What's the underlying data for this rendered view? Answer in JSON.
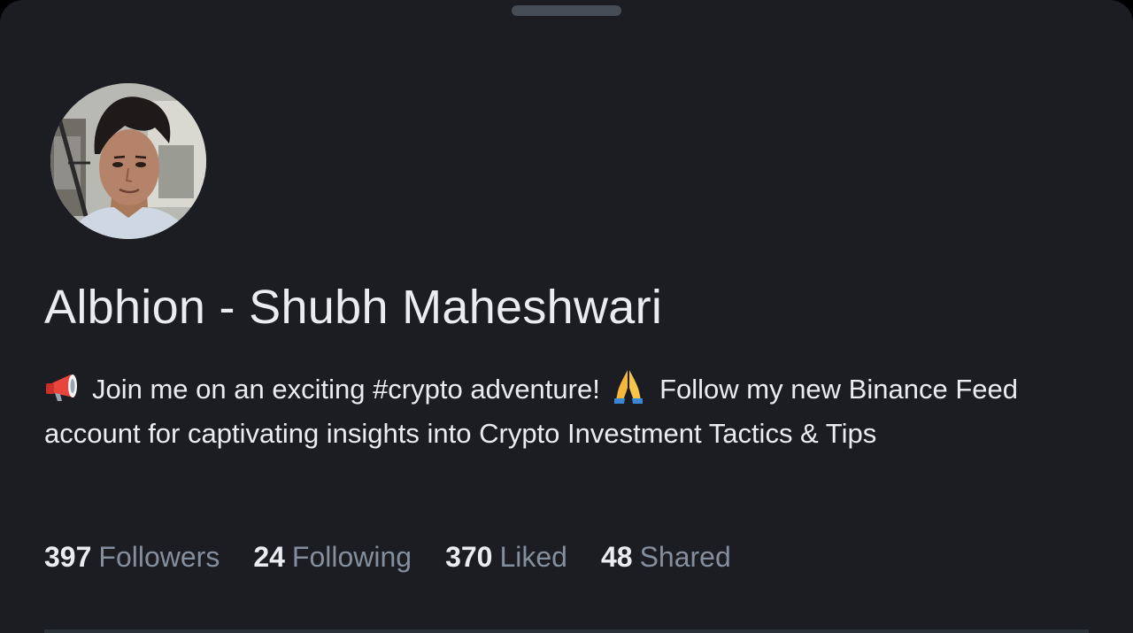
{
  "profile": {
    "name": "Albhion - Shubh Maheshwari",
    "bio": {
      "lead_icon": "megaphone-icon",
      "part1": "Join me on an exciting #crypto adventure!",
      "mid_icon": "folded-hands-icon",
      "part2": "Follow my new Binance Feed account for captivating insights into Crypto Investment Tactics & Tips"
    }
  },
  "stats": [
    {
      "value": "397",
      "label": "Followers"
    },
    {
      "value": "24",
      "label": "Following"
    },
    {
      "value": "370",
      "label": "Liked"
    },
    {
      "value": "48",
      "label": "Shared"
    }
  ],
  "colors": {
    "background": "#1b1d23",
    "primary_text": "#eaecef",
    "secondary_text": "#848e9c",
    "handle": "#474d57"
  }
}
